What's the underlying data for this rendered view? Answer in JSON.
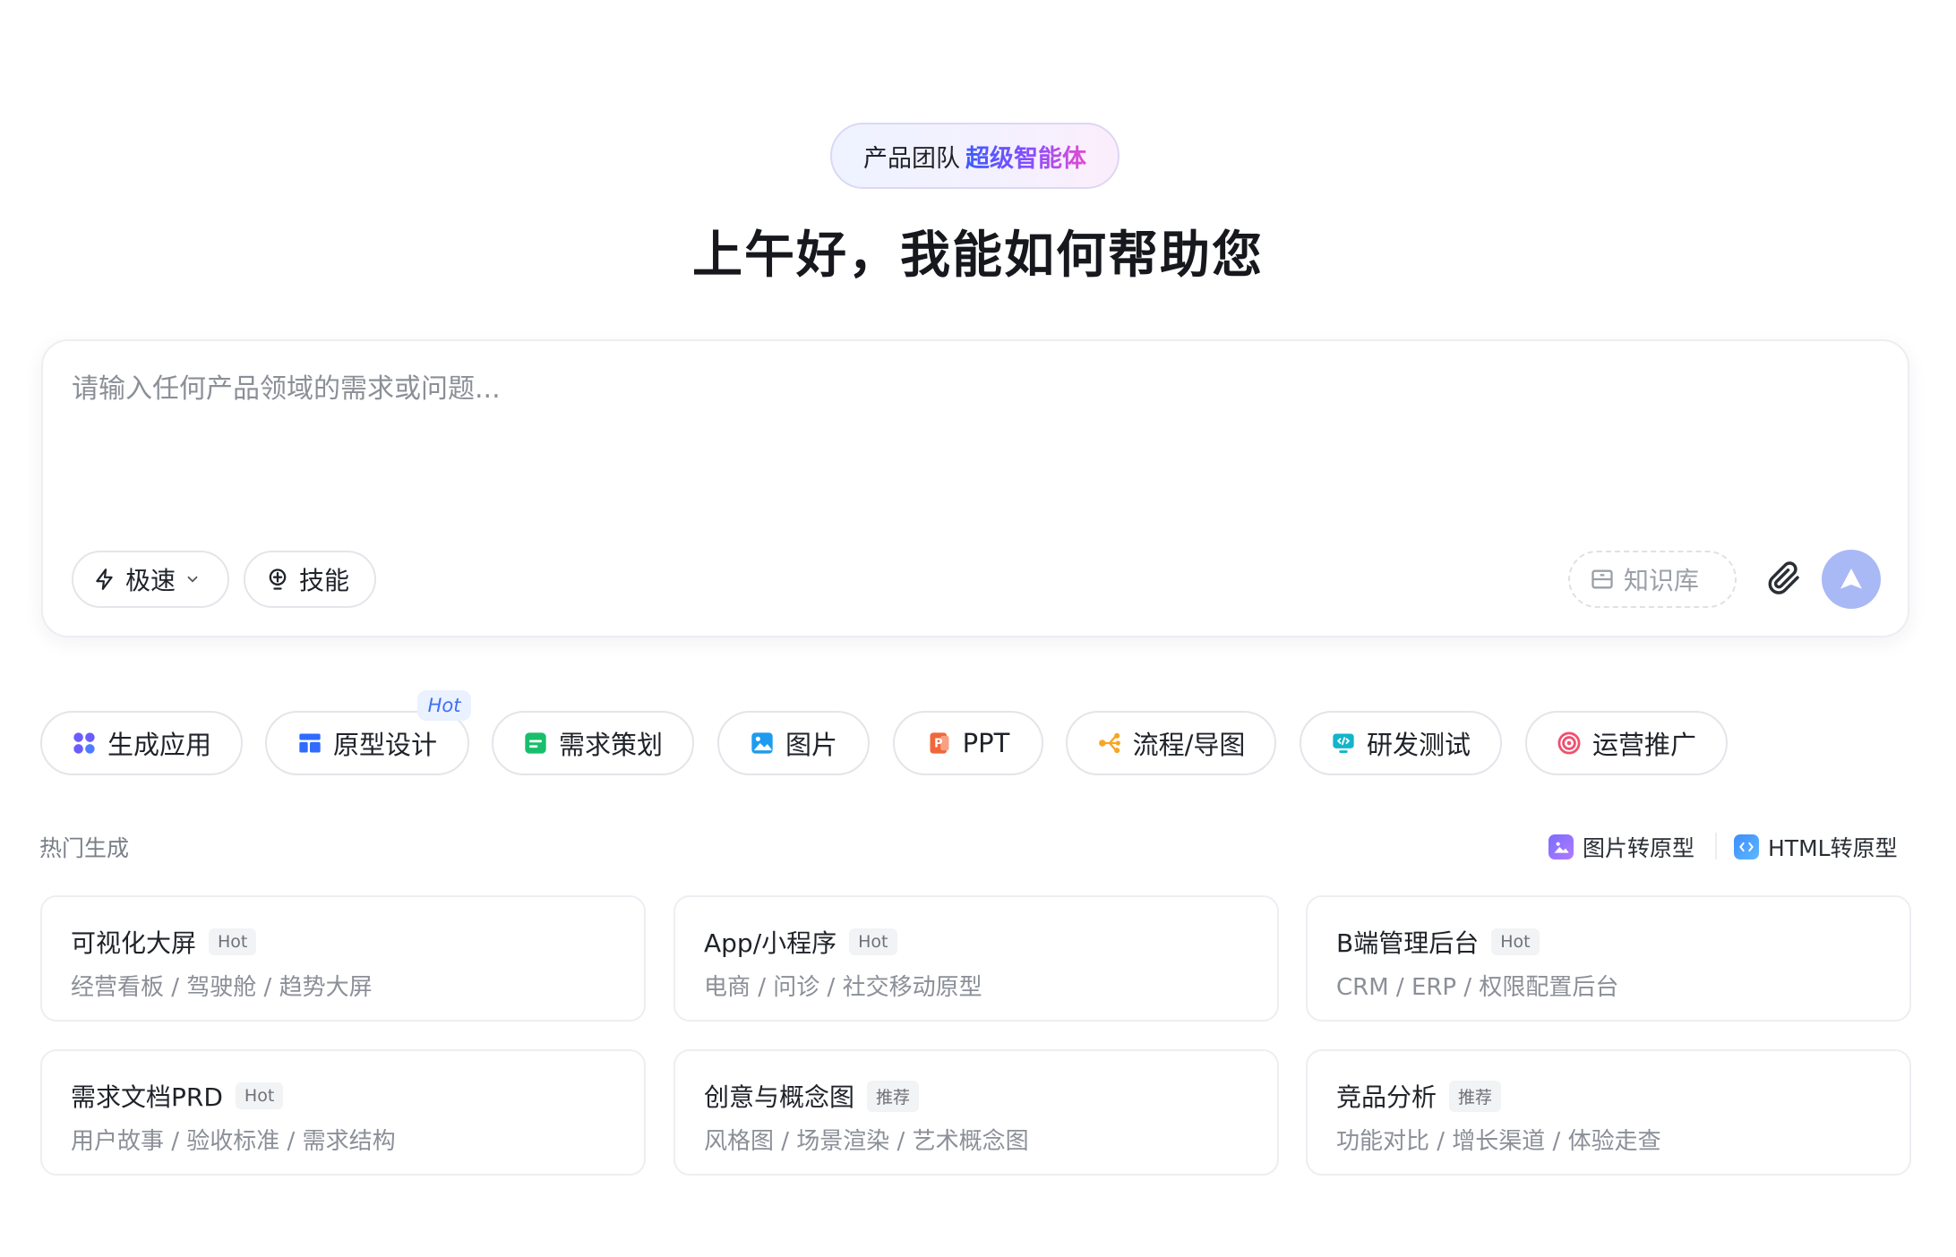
{
  "header": {
    "badge_plain": "产品团队",
    "badge_highlight": "超级智能体",
    "greeting": "上午好，我能如何帮助您"
  },
  "composer": {
    "placeholder": "请输入任何产品领域的需求或问题...",
    "mode_label": "极速",
    "skill_label": "技能",
    "knowledge_label": "知识库"
  },
  "categories": [
    {
      "label": "生成应用"
    },
    {
      "label": "原型设计",
      "tag": "Hot"
    },
    {
      "label": "需求策划"
    },
    {
      "label": "图片"
    },
    {
      "label": "PPT"
    },
    {
      "label": "流程/导图"
    },
    {
      "label": "研发测试"
    },
    {
      "label": "运营推广"
    }
  ],
  "hot": {
    "title": "热门生成",
    "links": [
      {
        "label": "图片转原型"
      },
      {
        "label": "HTML转原型"
      }
    ],
    "cards": [
      {
        "title": "可视化大屏",
        "tag": "Hot",
        "sub": "经营看板 / 驾驶舱 / 趋势大屏"
      },
      {
        "title": "App/小程序",
        "tag": "Hot",
        "sub": "电商 / 问诊 / 社交移动原型"
      },
      {
        "title": "B端管理后台",
        "tag": "Hot",
        "sub": "CRM / ERP / 权限配置后台"
      },
      {
        "title": "需求文档PRD",
        "tag": "Hot",
        "sub": "用户故事 / 验收标准 / 需求结构"
      },
      {
        "title": "创意与概念图",
        "tag": "推荐",
        "sub": "风格图 / 场景渲染 / 艺术概念图"
      },
      {
        "title": "竞品分析",
        "tag": "推荐",
        "sub": "功能对比 / 增长渠道 / 体验走查"
      }
    ]
  }
}
